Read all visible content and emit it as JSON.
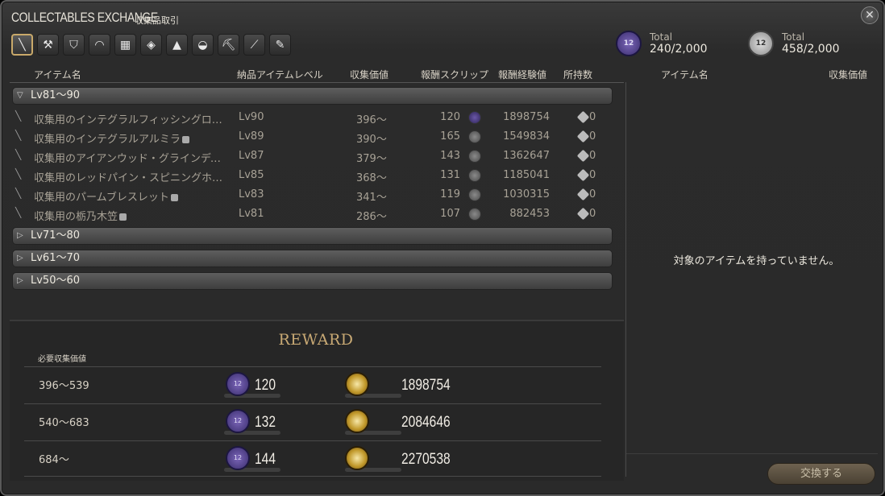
{
  "window": {
    "title": "COLLECTABLES EXCHANGE",
    "subtitle": "収集品取引",
    "close_icon": "close-icon"
  },
  "tabs": [
    {
      "icon": "carpenter-icon",
      "glyph": "╲",
      "active": true
    },
    {
      "icon": "blacksmith-icon",
      "glyph": "⚒"
    },
    {
      "icon": "armorer-icon",
      "glyph": "⛉"
    },
    {
      "icon": "goldsmith-icon",
      "glyph": "◠"
    },
    {
      "icon": "leatherworker-icon",
      "glyph": "▦"
    },
    {
      "icon": "weaver-icon",
      "glyph": "◈"
    },
    {
      "icon": "alchemist-icon",
      "glyph": "▲"
    },
    {
      "icon": "culinarian-icon",
      "glyph": "◒"
    },
    {
      "icon": "miner-icon",
      "glyph": "⛏"
    },
    {
      "icon": "botanist-icon",
      "glyph": "⟋"
    },
    {
      "icon": "fisher-icon",
      "glyph": "✎"
    }
  ],
  "scrips": [
    {
      "label": "Total",
      "value": "240/2,000",
      "color": "purple"
    },
    {
      "label": "Total",
      "value": "458/2,000",
      "color": "white"
    }
  ],
  "columns": {
    "item_name": "アイテム名",
    "level": "納品アイテムレベル",
    "collectability": "収集価値",
    "reward_scrip": "報酬スクリップ",
    "reward_exp": "報酬経験値",
    "owned": "所持数"
  },
  "right_columns": {
    "item_name": "アイテム名",
    "collectability": "収集価値"
  },
  "groups": [
    {
      "label": "Lv81～90",
      "expanded": true,
      "items": [
        {
          "name": "収集用のインテグラルフィッシングロ…",
          "level": "Lv90",
          "collect": "396～",
          "scrip": "120",
          "scrip_color": "purple",
          "exp": "1898754",
          "owned": "0"
        },
        {
          "name": "収集用のインテグラルアルミラ",
          "level": "Lv89",
          "collect": "390～",
          "scrip": "165",
          "scrip_color": "white",
          "exp": "1549834",
          "owned": "0"
        },
        {
          "name": "収集用のアイアンウッド・グラインディ…",
          "level": "Lv87",
          "collect": "379～",
          "scrip": "143",
          "scrip_color": "white",
          "exp": "1362647",
          "owned": "0"
        },
        {
          "name": "収集用のレッドパイン・スピニングホ…",
          "level": "Lv85",
          "collect": "368～",
          "scrip": "131",
          "scrip_color": "white",
          "exp": "1185041",
          "owned": "0"
        },
        {
          "name": "収集用のパームブレスレット",
          "level": "Lv83",
          "collect": "341～",
          "scrip": "119",
          "scrip_color": "white",
          "exp": "1030315",
          "owned": "0"
        },
        {
          "name": "収集用の栃乃木笠",
          "level": "Lv81",
          "collect": "286～",
          "scrip": "107",
          "scrip_color": "white",
          "exp": "882453",
          "owned": "0"
        }
      ]
    },
    {
      "label": "Lv71～80",
      "expanded": false
    },
    {
      "label": "Lv61～70",
      "expanded": false
    },
    {
      "label": "Lv50～60",
      "expanded": false
    }
  ],
  "reward": {
    "title": "REWARD",
    "subtitle": "必要収集価値",
    "rows": [
      {
        "range": "396～539",
        "scrip": "120",
        "exp": "1898754"
      },
      {
        "range": "540～683",
        "scrip": "132",
        "exp": "2084646"
      },
      {
        "range": "684～",
        "scrip": "144",
        "exp": "2270538"
      }
    ]
  },
  "right_panel": {
    "empty_message": "対象のアイテムを持っていません。",
    "exchange_button": "交換する"
  }
}
